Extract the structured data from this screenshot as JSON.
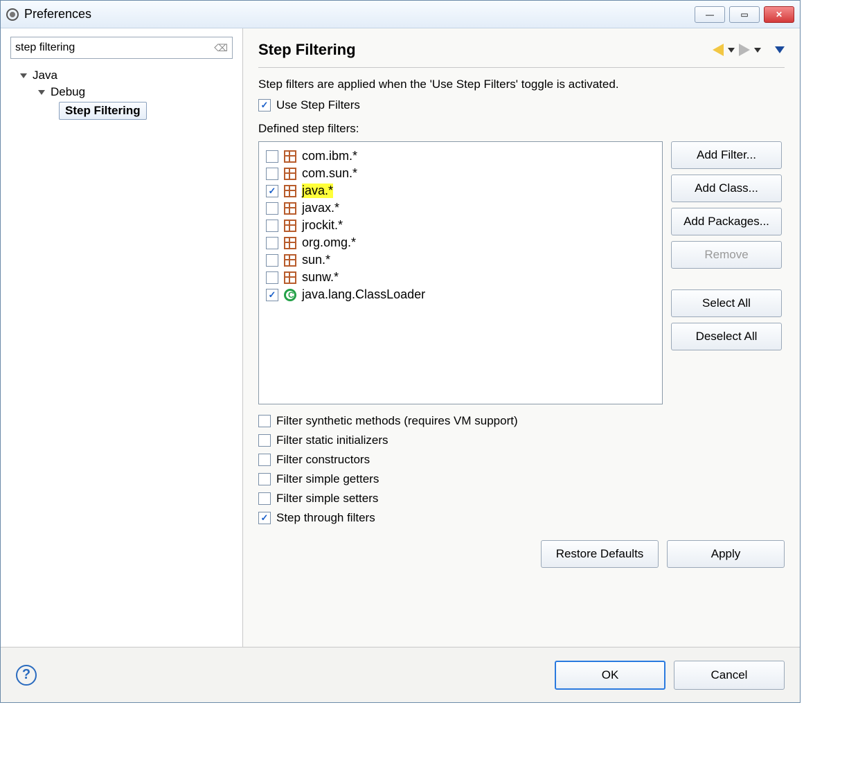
{
  "window": {
    "title": "Preferences"
  },
  "search": {
    "value": "step filtering"
  },
  "tree": {
    "root": "Java",
    "child": "Debug",
    "leaf": "Step Filtering"
  },
  "page": {
    "title": "Step Filtering",
    "description": "Step filters are applied when the 'Use Step Filters' toggle is activated.",
    "useStepFilters": {
      "label": "Use Step Filters",
      "checked": true
    },
    "definedLabel": "Defined step filters:",
    "filters": [
      {
        "label": "com.ibm.*",
        "checked": false,
        "type": "package",
        "highlight": false
      },
      {
        "label": "com.sun.*",
        "checked": false,
        "type": "package",
        "highlight": false
      },
      {
        "label": "java.*",
        "checked": true,
        "type": "package",
        "highlight": true
      },
      {
        "label": "javax.*",
        "checked": false,
        "type": "package",
        "highlight": false
      },
      {
        "label": "jrockit.*",
        "checked": false,
        "type": "package",
        "highlight": false
      },
      {
        "label": "org.omg.*",
        "checked": false,
        "type": "package",
        "highlight": false
      },
      {
        "label": "sun.*",
        "checked": false,
        "type": "package",
        "highlight": false
      },
      {
        "label": "sunw.*",
        "checked": false,
        "type": "package",
        "highlight": false
      },
      {
        "label": "java.lang.ClassLoader",
        "checked": true,
        "type": "class",
        "highlight": false
      }
    ],
    "buttons": {
      "addFilter": "Add Filter...",
      "addClass": "Add Class...",
      "addPackages": "Add Packages...",
      "remove": "Remove",
      "selectAll": "Select All",
      "deselectAll": "Deselect All"
    },
    "options": [
      {
        "label": "Filter synthetic methods (requires VM support)",
        "checked": false
      },
      {
        "label": "Filter static initializers",
        "checked": false
      },
      {
        "label": "Filter constructors",
        "checked": false
      },
      {
        "label": "Filter simple getters",
        "checked": false
      },
      {
        "label": "Filter simple setters",
        "checked": false
      },
      {
        "label": "Step through filters",
        "checked": true
      }
    ],
    "restoreDefaults": "Restore Defaults",
    "apply": "Apply"
  },
  "footer": {
    "ok": "OK",
    "cancel": "Cancel"
  }
}
